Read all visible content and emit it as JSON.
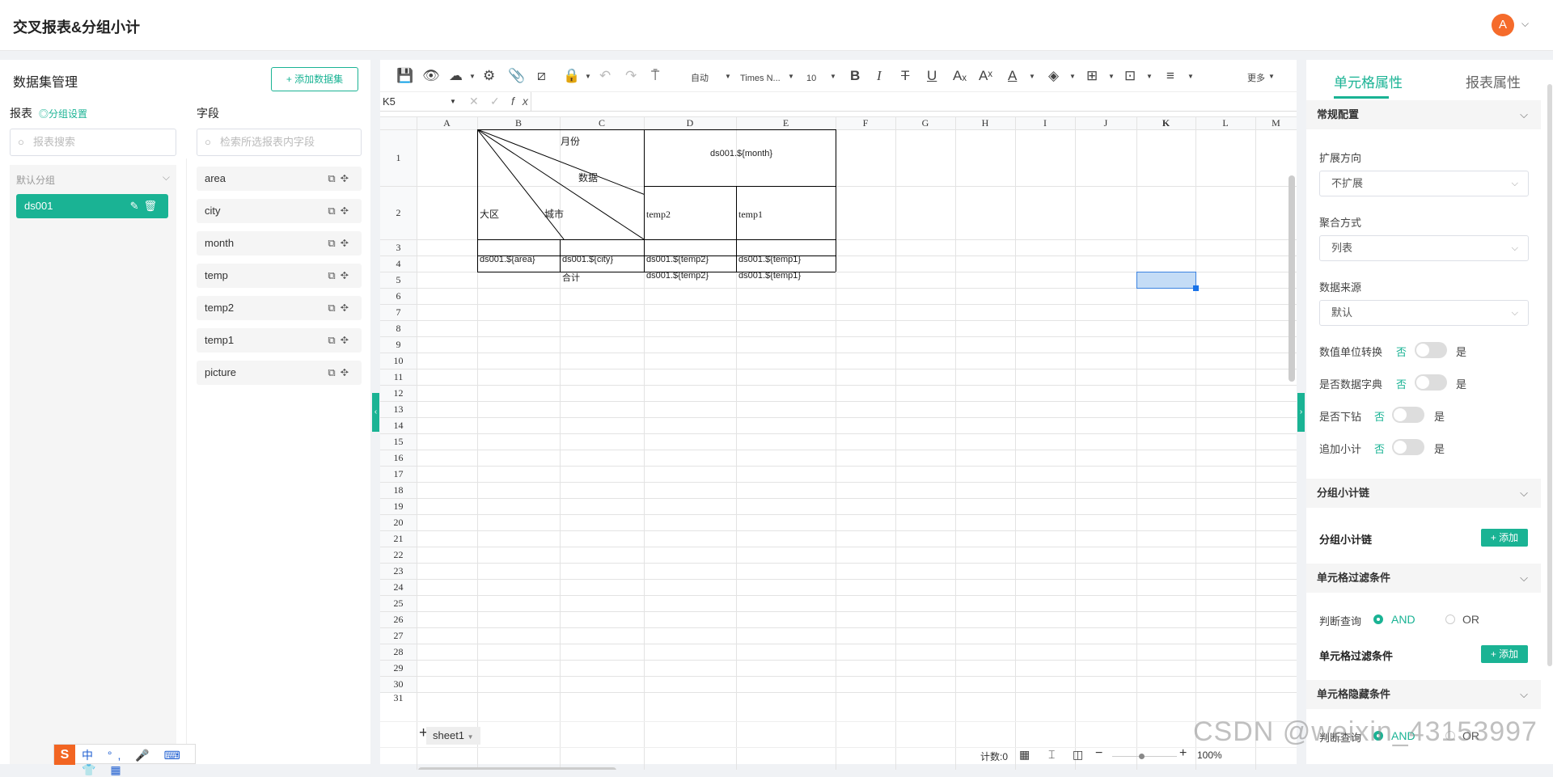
{
  "app": {
    "title": "交叉报表&分组小计",
    "avatar_letter": "A"
  },
  "left": {
    "title": "数据集管理",
    "add_dataset": "+ 添加数据集",
    "reports_label": "报表",
    "group_settings": "◎分组设置",
    "fields_label": "字段",
    "report_search_placeholder": "报表搜索",
    "field_search_placeholder": "检索所选报表内字段",
    "group_name": "默认分组",
    "dataset": "ds001",
    "fields": [
      "area",
      "city",
      "month",
      "temp",
      "temp2",
      "temp1",
      "picture"
    ]
  },
  "toolbar": {
    "auto": "自动",
    "font": "Times N...",
    "size": "10",
    "more": "更多"
  },
  "formula": {
    "cell_ref": "K5",
    "fx": "fx"
  },
  "sheet": {
    "columns": [
      "A",
      "B",
      "C",
      "D",
      "E",
      "F",
      "G",
      "H",
      "I",
      "J",
      "K",
      "L",
      "M"
    ],
    "rows": [
      "1",
      "2",
      "3",
      "4",
      "5",
      "6",
      "7",
      "8",
      "9",
      "10",
      "11",
      "12",
      "13",
      "14",
      "15",
      "16",
      "17",
      "18",
      "19",
      "20",
      "21",
      "22",
      "23",
      "24",
      "25",
      "26",
      "27",
      "28",
      "29",
      "30",
      "31"
    ],
    "diag_month": "月份",
    "diag_data": "数据",
    "diag_region": "大区",
    "diag_city": "城市",
    "d1": "ds001.${month}",
    "d2": "temp2",
    "e2": "temp1",
    "b3": "ds001.${area}",
    "c3": "ds001.${city}",
    "d3": "ds001.${temp2}",
    "e3": "ds001.${temp1}",
    "c4": "合计",
    "d4": "ds001.${temp2}",
    "e4": "ds001.${temp1}",
    "tab": "sheet1",
    "count": "计数:0",
    "zoom": "100%"
  },
  "right": {
    "tab_cell": "单元格属性",
    "tab_report": "报表属性",
    "sec_general": "常规配置",
    "expand_label": "扩展方向",
    "expand_value": "不扩展",
    "agg_label": "聚合方式",
    "agg_value": "列表",
    "source_label": "数据来源",
    "source_value": "默认",
    "unit_conv": "数值单位转换",
    "dict": "是否数据字典",
    "drill": "是否下钻",
    "subtotal": "追加小计",
    "no": "否",
    "yes": "是",
    "sec_group_chain": "分组小计链",
    "group_chain_label": "分组小计链",
    "add": "+ 添加",
    "sec_filter": "单元格过滤条件",
    "judge_query": "判断查询",
    "and": "AND",
    "or": "OR",
    "filter_label": "单元格过滤条件",
    "sec_hide": "单元格隐藏条件"
  },
  "watermark": "CSDN @weixin_43153997",
  "ime": {
    "logo": "S",
    "items": "中 °, 🎤 ⌨ 👕 ▦"
  }
}
